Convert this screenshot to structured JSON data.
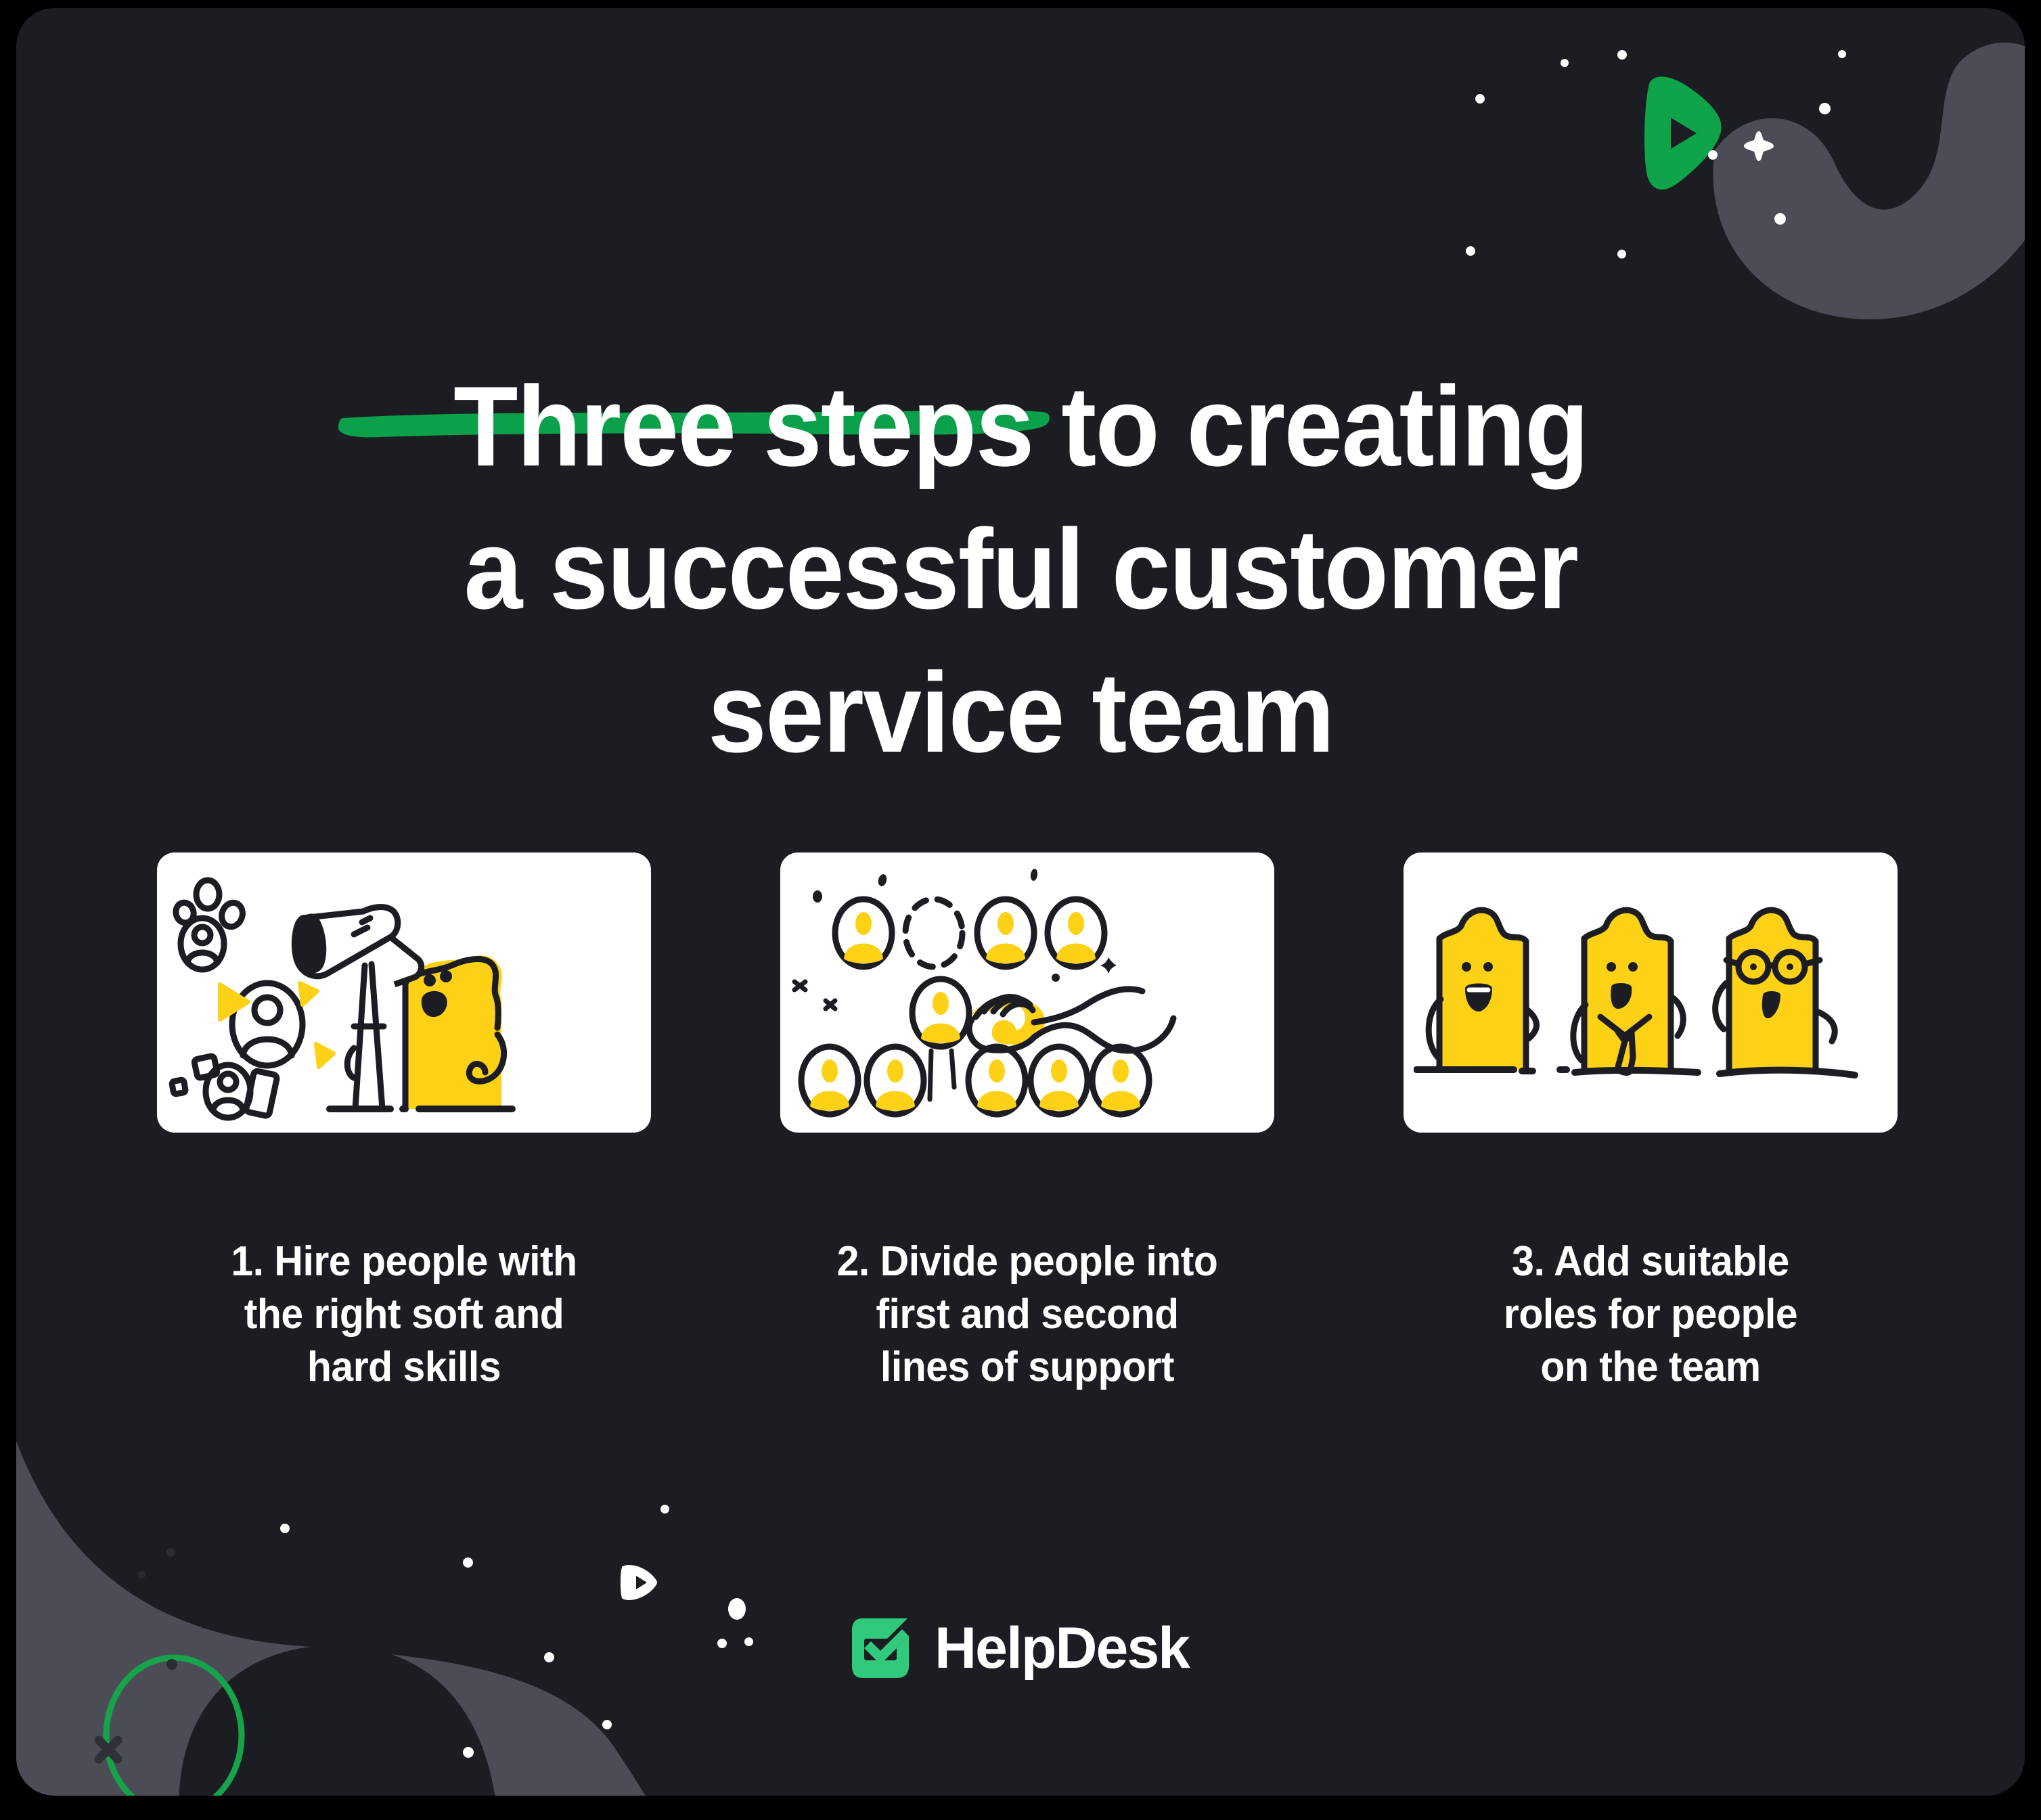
{
  "theme": {
    "outer_background": "#000000",
    "board_background": "#1C1D22",
    "card_background": "#FFFFFF",
    "text_primary": "#FFFFFF",
    "accent_green": "#0BA14B",
    "logo_green": "#31C97B",
    "illustration_yellow": "#FCD116",
    "illustration_ink": "#1C1D22",
    "blob_gray": "#4B4C55"
  },
  "header": {
    "title": "Three steps to creating\na successful customer\nservice team",
    "underlined_phrase": "Three steps"
  },
  "steps": [
    {
      "number": "1",
      "caption": "1. Hire people with\nthe right soft and\nhard skills",
      "illustration": "telescope-character-scanning-avatars"
    },
    {
      "number": "2",
      "caption": "2. Divide people into\nfirst and second\nlines of support",
      "illustration": "hand-moving-avatar-between-rows"
    },
    {
      "number": "3",
      "caption": "3. Add suitable\nroles for people\non the team",
      "illustration": "three-characters-with-roles"
    }
  ],
  "footer": {
    "brand_name": "HelpDesk",
    "logo_icon": "checkbox-check-icon"
  },
  "decorations": {
    "top_right": [
      "gray-kidney-blob",
      "green-play-badge",
      "white-sparkle-plus",
      "white-dots"
    ],
    "bottom_left": [
      "gray-wave-blob",
      "green-circle-outline",
      "dark-x-mark",
      "white-play-triangle",
      "white-dots"
    ]
  }
}
